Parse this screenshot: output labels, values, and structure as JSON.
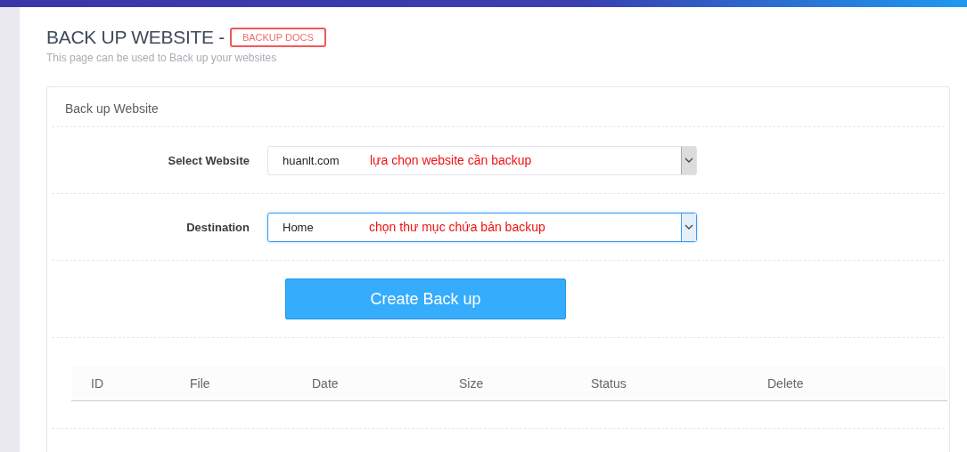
{
  "page": {
    "title": "BACK UP WEBSITE -",
    "docs_link": "BACKUP DOCS",
    "subtitle": "This page can be used to Back up your websites"
  },
  "card": {
    "title": "Back up Website",
    "fields": [
      {
        "label": "Select Website",
        "value": "huanlt.com",
        "annotation": "lựa chọn website cần backup",
        "focused": false
      },
      {
        "label": "Destination",
        "value": "Home",
        "annotation": "chọn thư mục chứa bản backup",
        "focused": true
      }
    ],
    "button": "Create Back up",
    "table": {
      "columns": [
        "ID",
        "File",
        "Date",
        "Size",
        "Status",
        "Delete"
      ]
    }
  }
}
